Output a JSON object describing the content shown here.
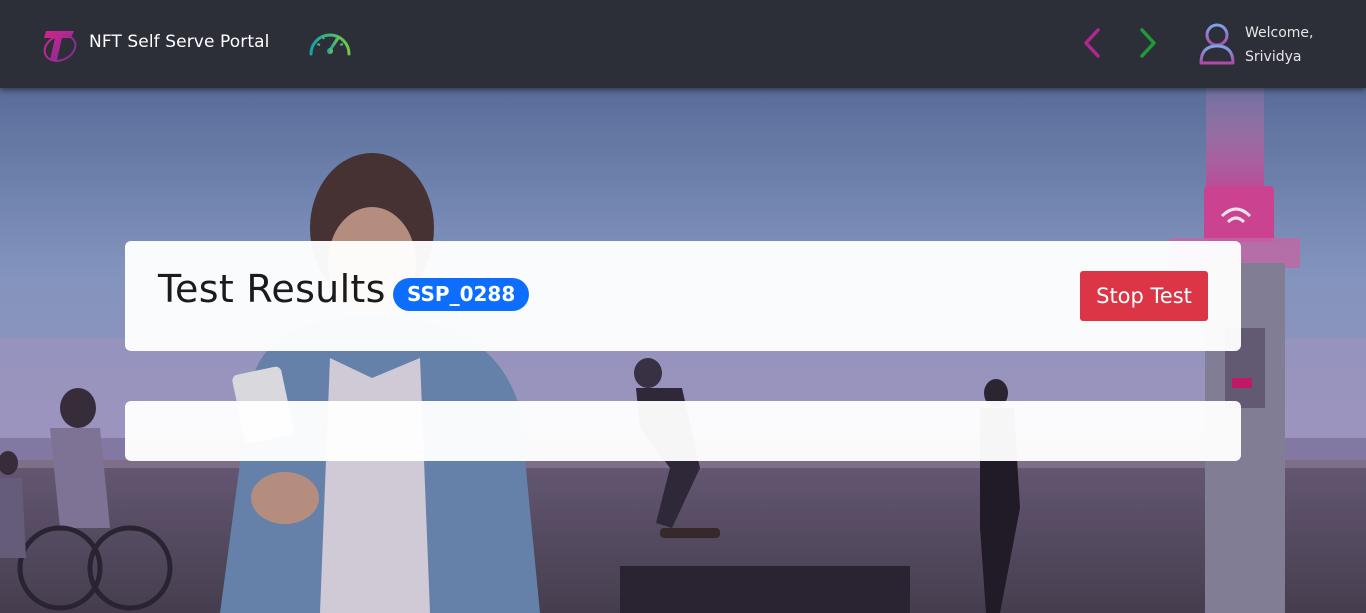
{
  "header": {
    "app_title": "NFT Self Serve Portal",
    "logo_icon": "telstra-t-logo",
    "dashboard_icon": "speedometer-icon",
    "nav": {
      "back_icon": "chevron-left-icon",
      "forward_icon": "chevron-right-icon",
      "back_color": "#b0278f",
      "forward_color": "#1f9a3a"
    },
    "user": {
      "avatar_icon": "user-avatar-icon",
      "greeting": "Welcome,",
      "name": "Srividya"
    }
  },
  "results": {
    "title": "Test Results",
    "test_id": "SSP_0288",
    "stop_label": "Stop Test"
  },
  "colors": {
    "header_bg": "#2c2f38",
    "badge_bg": "#0d6efd",
    "stop_bg": "#dc3545",
    "accent_magenta": "#d6196e"
  }
}
